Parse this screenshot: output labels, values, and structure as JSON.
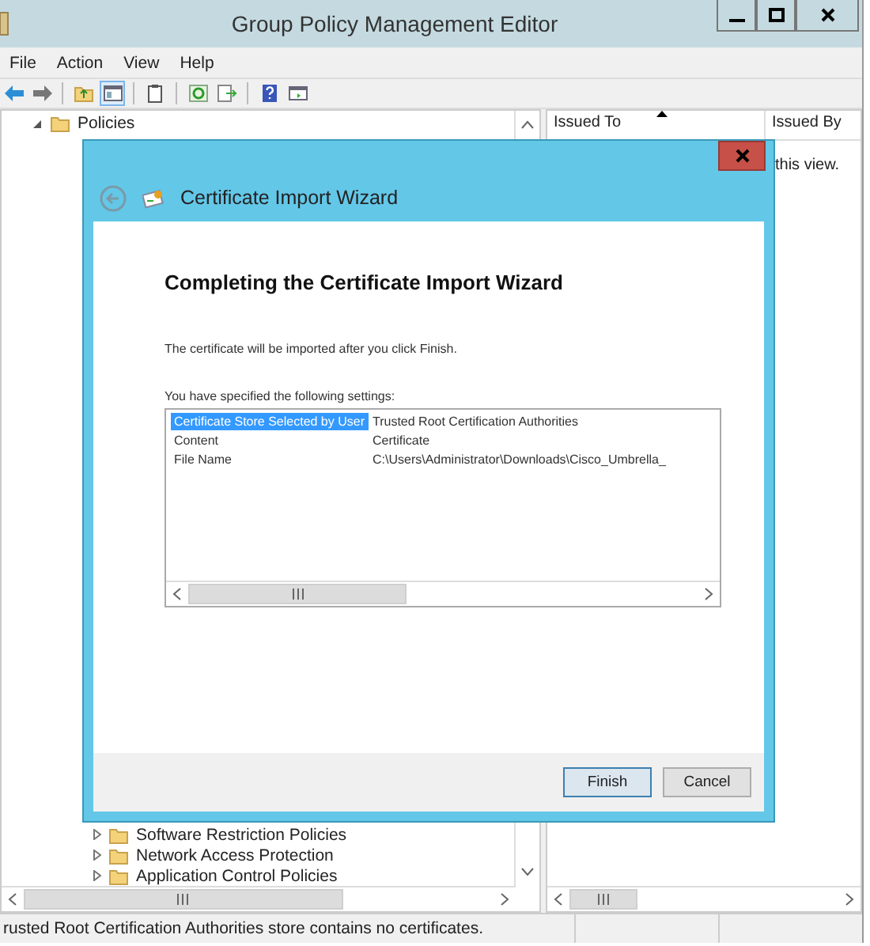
{
  "window": {
    "title": "Group Policy Management Editor"
  },
  "menu": [
    {
      "label": "File"
    },
    {
      "label": "Action"
    },
    {
      "label": "View"
    },
    {
      "label": "Help"
    }
  ],
  "toolbar": [
    {
      "kind": "back"
    },
    {
      "kind": "forward"
    },
    {
      "kind": "sep"
    },
    {
      "kind": "up",
      "selected": false
    },
    {
      "kind": "pane",
      "selected": true
    },
    {
      "kind": "sep"
    },
    {
      "kind": "clipboard",
      "selected": false
    },
    {
      "kind": "sep"
    },
    {
      "kind": "refresh",
      "selected": false
    },
    {
      "kind": "export",
      "selected": false
    },
    {
      "kind": "sep"
    },
    {
      "kind": "help",
      "selected": false
    },
    {
      "kind": "props",
      "selected": false
    }
  ],
  "tree": {
    "top": [
      {
        "label": "Policies",
        "expanded": true
      }
    ],
    "bottom": [
      {
        "label": "Software Restriction Policies",
        "expanded": false
      },
      {
        "label": "Network Access Protection",
        "expanded": false
      },
      {
        "label": "Application Control Policies",
        "expanded": false
      }
    ]
  },
  "list": {
    "columns": [
      {
        "label": "Issued To",
        "sorted": true
      },
      {
        "label": "Issued By",
        "sorted": false
      }
    ],
    "message": "this view."
  },
  "status_bar": "rusted Root Certification Authorities store contains no certificates.",
  "dialog": {
    "title": "Certificate Import Wizard",
    "heading": "Completing the Certificate Import Wizard",
    "intro": "The certificate will be imported after you click Finish.",
    "settings_label": "You have specified the following settings:",
    "settings": [
      {
        "name": "Certificate Store Selected by User",
        "value": "Trusted Root Certification Authorities",
        "selected": true
      },
      {
        "name": "Content",
        "value": "Certificate",
        "selected": false
      },
      {
        "name": "File Name",
        "value": "C:\\Users\\Administrator\\Downloads\\Cisco_Umbrella_",
        "selected": false
      }
    ],
    "buttons": [
      {
        "label": "Finish",
        "default": true
      },
      {
        "label": "Cancel",
        "default": false
      }
    ]
  }
}
